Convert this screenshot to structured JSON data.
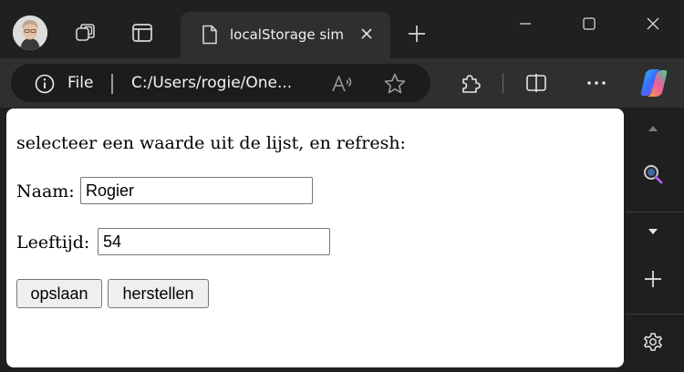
{
  "browser": {
    "tab_title": "localStorage sim",
    "address_scheme": "File",
    "address_url": "C:/Users/rogie/One..."
  },
  "icons": {
    "avatar": "profile-avatar",
    "workspaces": "workspaces-icon",
    "tab_actions": "tab-actions-icon",
    "document": "document-icon",
    "close": "close-icon",
    "new_tab": "plus-icon",
    "minimize": "minimize-icon",
    "maximize": "maximize-icon",
    "window_close": "close-icon",
    "info": "info-icon",
    "read_aloud": "read-aloud-icon",
    "favorite": "star-icon",
    "extensions": "puzzle-icon",
    "split_screen": "split-screen-icon",
    "more": "more-icon",
    "copilot": "copilot-icon",
    "search": "search-icon",
    "settings": "gear-icon"
  },
  "page": {
    "intro": "selecteer een waarde uit de lijst, en refresh:",
    "name_label": "Naam:",
    "name_value": "Rogier",
    "age_label": "Leeftijd:",
    "age_value": "54",
    "save_button": "opslaan",
    "restore_button": "herstellen"
  },
  "colors": {
    "chrome_bg": "#202020",
    "toolbar_bg": "#2f2f2f",
    "page_bg": "#ffffff",
    "button_bg": "#efefef"
  }
}
